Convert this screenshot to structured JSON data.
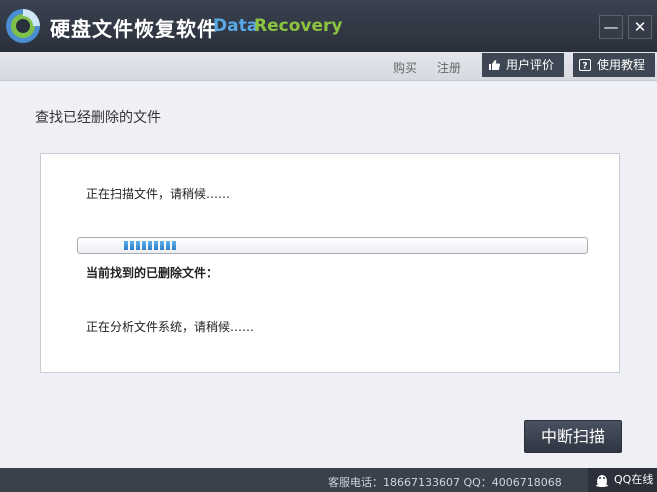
{
  "window": {
    "title_cn": "硬盘文件恢复软件",
    "title_en_part1": "Data",
    "title_en_part2": "Recovery",
    "minimize_label": "—",
    "close_label": "✕"
  },
  "toolbar": {
    "buy_label": "购买",
    "register_label": "注册",
    "review_label": "用户评价",
    "tutorial_label": "使用教程"
  },
  "main": {
    "heading": "查找已经删除的文件",
    "scan_status": "正在扫描文件，请稍候……",
    "found_label": "当前找到的已删除文件：",
    "analyze_status": "正在分析文件系统，请稍候……",
    "progress_fraction": 0.2,
    "stop_button_label": "中断扫描"
  },
  "statusbar": {
    "contact_text": "客服电话：18667133607 QQ：4006718068",
    "qq_online_label": "QQ在线"
  },
  "colors": {
    "accent_blue": "#5aa9e6",
    "accent_green": "#8cc43f",
    "titlebar_bg": "#2f3541"
  }
}
